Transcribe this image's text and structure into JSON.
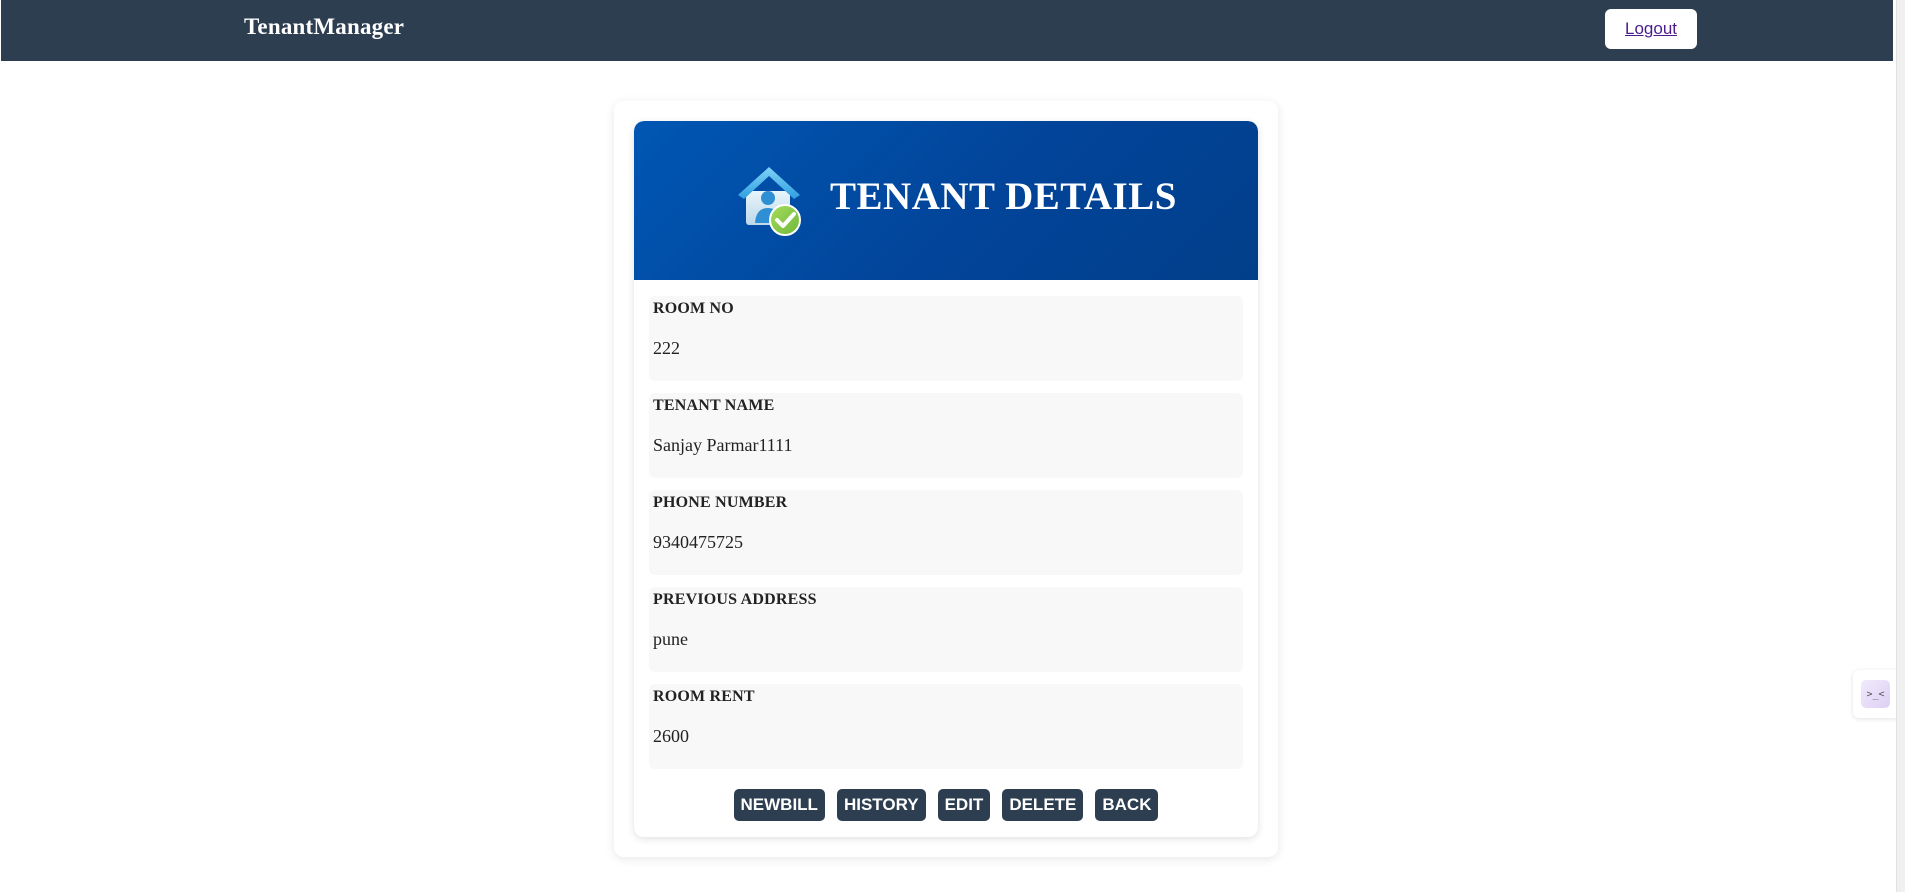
{
  "navbar": {
    "brand": "TenantManager",
    "logout_label": "Logout"
  },
  "card": {
    "title": "TENANT DETAILS",
    "icon": "house-check-icon",
    "fields": [
      {
        "label": "ROOM NO",
        "value": "222"
      },
      {
        "label": "TENANT NAME",
        "value": "Sanjay Parmar1111"
      },
      {
        "label": "PHONE NUMBER",
        "value": "9340475725"
      },
      {
        "label": "PREVIOUS ADDRESS",
        "value": "pune"
      },
      {
        "label": "ROOM RENT",
        "value": "2600"
      }
    ],
    "actions": [
      {
        "label": "NEWBILL"
      },
      {
        "label": "HISTORY"
      },
      {
        "label": "EDIT"
      },
      {
        "label": "DELETE"
      },
      {
        "label": "BACK"
      }
    ]
  },
  "side_widget": {
    "icon": "face-icon",
    "glyph": ">_<"
  },
  "colors": {
    "navbar": "#2d3e50",
    "header_gradient_start": "#0057b3",
    "header_gradient_end": "#023f8a",
    "button": "#2d3e50",
    "field_bg": "#f8f8f8"
  }
}
